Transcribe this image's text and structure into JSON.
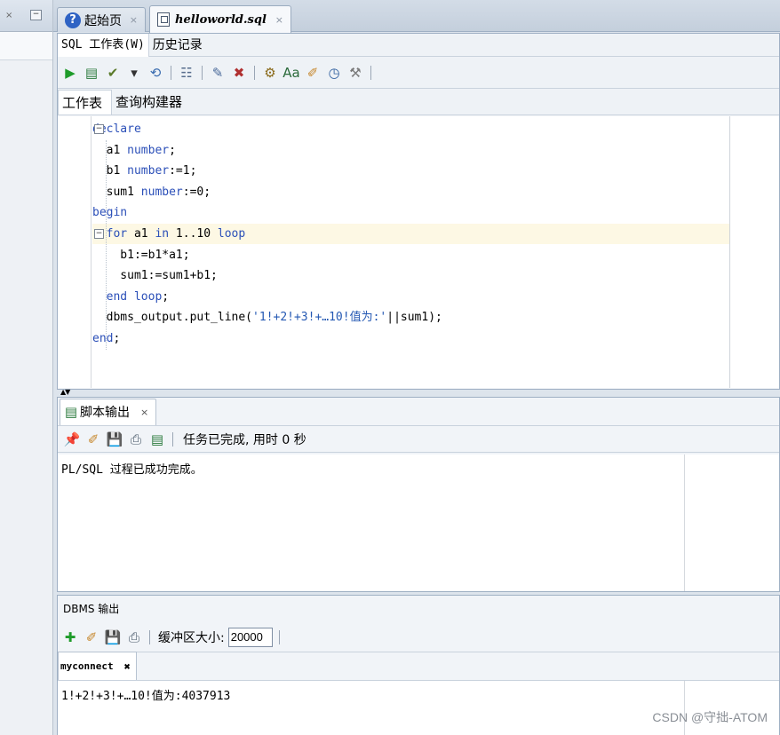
{
  "left_pane": {
    "close_glyph": "×",
    "minimize_glyph": "−"
  },
  "doc_tabs": [
    {
      "label": "起始页",
      "icon": "help-icon",
      "close": "×"
    },
    {
      "label": "helloworld.sql",
      "icon": "database-sql-icon",
      "close": "×"
    }
  ],
  "sub_tabs": [
    "SQL 工作表(W)",
    "历史记录"
  ],
  "toolbar_icons": [
    {
      "name": "run-statement-icon",
      "glyph": "▶",
      "color": "#1e9b2a"
    },
    {
      "name": "run-script-icon",
      "glyph": "▤",
      "color": "#2a7a3c"
    },
    {
      "name": "commit-icon",
      "glyph": "✔",
      "color": "#5a7a2a"
    },
    {
      "name": "dropdown-arrow-icon",
      "glyph": "▾",
      "color": "#333333"
    },
    {
      "name": "rollback-icon",
      "glyph": "⟲",
      "color": "#3b6db0"
    },
    {
      "name": "explain-plan-icon",
      "glyph": "☷",
      "color": "#566c8c"
    },
    {
      "name": "autotrace-icon",
      "glyph": "✎",
      "color": "#4a6a9a"
    },
    {
      "name": "clear-icon",
      "glyph": "✖",
      "color": "#b03030"
    },
    {
      "name": "sql-tuning-icon",
      "glyph": "⚙",
      "color": "#8a6a1a"
    },
    {
      "name": "format-icon",
      "glyph": "Aa",
      "color": "#2a6a3a"
    },
    {
      "name": "eraser-icon",
      "glyph": "✐",
      "color": "#c6862a"
    },
    {
      "name": "history-icon",
      "glyph": "◷",
      "color": "#2f5f9f"
    },
    {
      "name": "tools-icon",
      "glyph": "⚒",
      "color": "#7a7a7a"
    }
  ],
  "worksheet_tabs": [
    "工作表",
    "查询构建器"
  ],
  "code": {
    "lines": [
      [
        {
          "t": "declare",
          "k": "kw"
        }
      ],
      [
        {
          "t": "  a1 ",
          "k": ""
        },
        {
          "t": "number",
          "k": "kw"
        },
        {
          "t": ";",
          "k": ""
        }
      ],
      [
        {
          "t": "  b1 ",
          "k": ""
        },
        {
          "t": "number",
          "k": "kw"
        },
        {
          "t": ":=1;",
          "k": ""
        }
      ],
      [
        {
          "t": "  sum1 ",
          "k": ""
        },
        {
          "t": "number",
          "k": "kw"
        },
        {
          "t": ":=0;",
          "k": ""
        }
      ],
      [
        {
          "t": "begin",
          "k": "kw"
        }
      ],
      [
        {
          "t": "  ",
          "k": ""
        },
        {
          "t": "for",
          "k": "kw"
        },
        {
          "t": " a1 ",
          "k": ""
        },
        {
          "t": "in",
          "k": "kw"
        },
        {
          "t": " 1..10 ",
          "k": ""
        },
        {
          "t": "loop",
          "k": "kw"
        }
      ],
      [
        {
          "t": "    b1:=b1*a1;",
          "k": ""
        }
      ],
      [
        {
          "t": "    sum1:=sum1+b1;",
          "k": ""
        }
      ],
      [
        {
          "t": "  ",
          "k": ""
        },
        {
          "t": "end loop",
          "k": "kw"
        },
        {
          "t": ";",
          "k": ""
        }
      ],
      [
        {
          "t": "  dbms_output.put_line(",
          "k": ""
        },
        {
          "t": "'1!+2!+3!+…10!值为:'",
          "k": "str"
        },
        {
          "t": "||sum1);",
          "k": ""
        }
      ],
      [
        {
          "t": "end",
          "k": "kw"
        },
        {
          "t": ";",
          "k": ""
        }
      ]
    ],
    "highlighted_line": 5,
    "fold_markers": [
      0,
      5
    ]
  },
  "splitter_arrows": "▲▼",
  "script_output": {
    "tab_label": "脚本输出",
    "tab_close": "×",
    "status": "任务已完成, 用时 0 秒",
    "text": "PL/SQL 过程已成功完成。",
    "toolbar_icons": [
      {
        "name": "pin-icon",
        "glyph": "📌",
        "color": "#c0302a"
      },
      {
        "name": "eraser-icon",
        "glyph": "✐",
        "color": "#c6862a"
      },
      {
        "name": "save-icon",
        "glyph": "💾",
        "color": "#2f5f9f"
      },
      {
        "name": "print-icon",
        "glyph": "⎙",
        "color": "#4a5a6a"
      },
      {
        "name": "script-icon",
        "glyph": "▤",
        "color": "#2a7a3c"
      }
    ]
  },
  "dbms_output": {
    "title": "DBMS 输出",
    "buffer_label": "缓冲区大小:",
    "buffer_value": "20000",
    "connection_tab": "myconnect",
    "connection_close": "✖",
    "text": "1!+2!+3!+…10!值为:4037913",
    "toolbar_icons": [
      {
        "name": "add-icon",
        "glyph": "✚",
        "color": "#1e9b2a"
      },
      {
        "name": "eraser-icon",
        "glyph": "✐",
        "color": "#c6862a"
      },
      {
        "name": "save-icon",
        "glyph": "💾",
        "color": "#2f5f9f"
      },
      {
        "name": "print-icon",
        "glyph": "⎙",
        "color": "#4a5a6a"
      }
    ]
  },
  "watermark": "CSDN @守拙-ATOM"
}
